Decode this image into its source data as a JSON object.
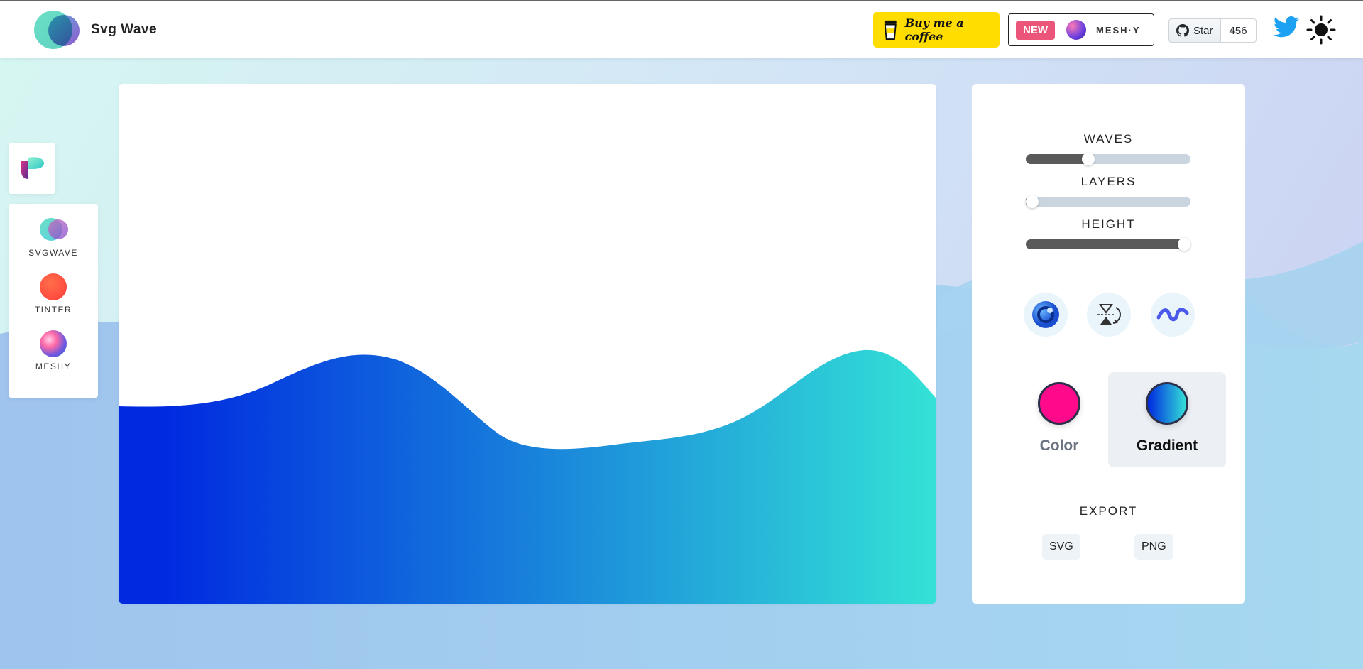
{
  "header": {
    "brand_name": "Svg Wave",
    "coffee_label": "Buy me a coffee",
    "new_badge": "NEW",
    "meshy_label": "MESH·Y",
    "github_star_label": "Star",
    "github_star_count": "456"
  },
  "sidebar": {
    "apps": [
      {
        "label": "SVGWAVE",
        "icon": "svgwave-icon"
      },
      {
        "label": "TINTER",
        "icon": "tinter-icon"
      },
      {
        "label": "MESHY",
        "icon": "meshy-icon"
      }
    ]
  },
  "controls": {
    "waves": {
      "label": "WAVES",
      "value_fraction": 0.38
    },
    "layers": {
      "label": "LAYERS",
      "value_fraction": 0.04
    },
    "height": {
      "label": "HEIGHT",
      "value_fraction": 0.96
    },
    "action_icons": [
      "randomize-icon",
      "flip-icon",
      "wave-type-icon"
    ],
    "color_mode": {
      "options": [
        "Color",
        "Gradient"
      ],
      "selected": "Gradient",
      "solid_color": "#ff0a8a",
      "gradient_start": "#0029e0",
      "gradient_end": "#33e1d6"
    },
    "export": {
      "label": "EXPORT",
      "svg_label": "SVG",
      "png_label": "PNG"
    }
  },
  "colors": {
    "accent_yellow": "#ffdd00",
    "new_badge": "#ea5579",
    "twitter": "#1da1f2"
  }
}
